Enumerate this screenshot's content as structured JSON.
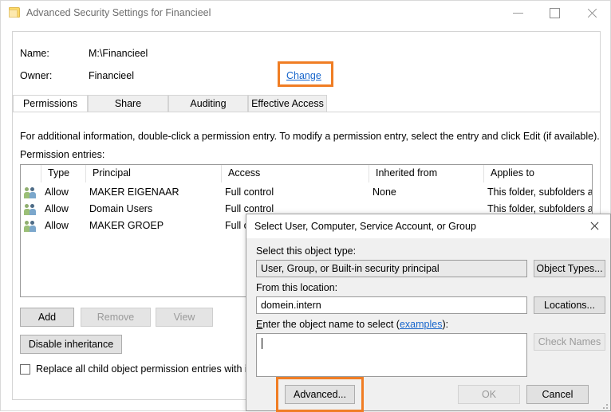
{
  "window": {
    "title": "Advanced Security Settings for Financieel",
    "icon": "folder-icon",
    "controls": {
      "minimize": "—",
      "maximize": "□",
      "close": "✕"
    }
  },
  "header": {
    "name_label": "Name:",
    "name_value": "M:\\Financieel",
    "owner_label": "Owner:",
    "owner_value": "Financieel",
    "change_link": "Change"
  },
  "tabs": [
    {
      "label": "Permissions",
      "active": true
    },
    {
      "label": "Share",
      "active": false
    },
    {
      "label": "Auditing",
      "active": false
    },
    {
      "label": "Effective Access",
      "active": false
    }
  ],
  "main": {
    "info_text": "For additional information, double-click a permission entry. To modify a permission entry, select the entry and click Edit (if available).",
    "entries_label": "Permission entries:",
    "columns": [
      "",
      "Type",
      "Principal",
      "Access",
      "Inherited from",
      "Applies to"
    ],
    "rows": [
      {
        "icon": "users-group-icon",
        "type": "Allow",
        "principal": "MAKER EIGENAAR",
        "access": "Full control",
        "inherited_from": "None",
        "applies_to": "This folder, subfolders and files"
      },
      {
        "icon": "users-group-icon",
        "type": "Allow",
        "principal": "Domain Users",
        "access": "Full control",
        "inherited_from": "",
        "applies_to": "This folder, subfolders and files"
      },
      {
        "icon": "users-group-icon",
        "type": "Allow",
        "principal": "MAKER GROEP",
        "access": "Full control",
        "inherited_from": "",
        "applies_to": ""
      }
    ],
    "buttons": {
      "add": "Add",
      "remove": "Remove",
      "view": "View",
      "disable_inheritance": "Disable inheritance"
    },
    "replace_checkbox_label": "Replace all child object permission entries with inheritable permission entries from this object",
    "replace_checkbox_checked": false
  },
  "modal": {
    "title": "Select User, Computer, Service Account, or Group",
    "object_type_label": "Select this object type:",
    "object_type_value": "User, Group, or Built-in security principal",
    "object_types_button": "Object Types...",
    "location_label": "From this location:",
    "location_value": "domein.intern",
    "locations_button": "Locations...",
    "object_name_label_pre": "E",
    "object_name_label_mid": "nter the object name to select (",
    "object_name_link": "examples",
    "object_name_label_post": "):",
    "object_name_value": "",
    "check_names_button": "Check Names",
    "advanced_button": "Advanced...",
    "ok_button": "OK",
    "cancel_button": "Cancel"
  },
  "highlights": {
    "color": "#f07d24",
    "targets": [
      "change-link",
      "advanced-button"
    ]
  }
}
